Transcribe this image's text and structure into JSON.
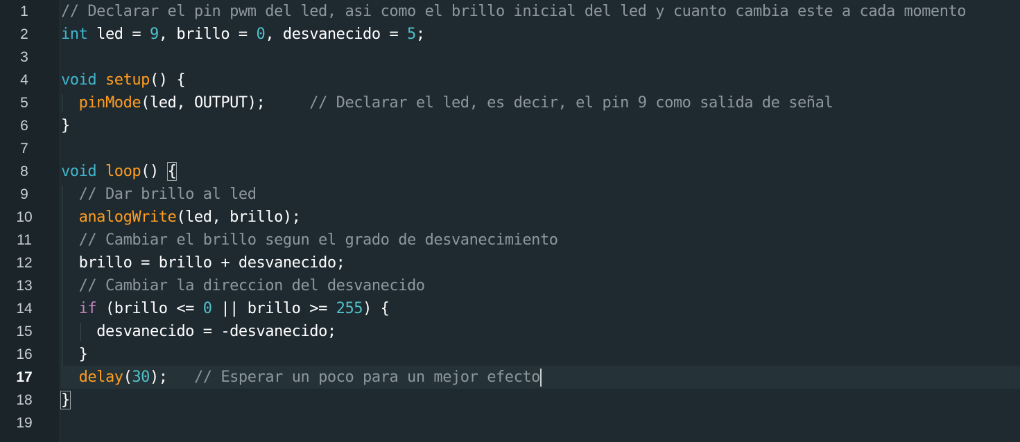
{
  "editor": {
    "active_line": 17,
    "line_numbers": [
      "1",
      "2",
      "3",
      "4",
      "5",
      "6",
      "7",
      "8",
      "9",
      "10",
      "11",
      "12",
      "13",
      "14",
      "15",
      "16",
      "17",
      "18",
      "19"
    ]
  },
  "code": {
    "l1_comment": "// Declarar el pin pwm del led, asi como el brillo inicial del led y cuanto cambia este a cada momento",
    "l2_int": "int",
    "l2_a": " led = ",
    "l2_n1": "9",
    "l2_b": ", brillo = ",
    "l2_n2": "0",
    "l2_c": ", desvanecido = ",
    "l2_n3": "5",
    "l2_d": ";",
    "l4_void": "void",
    "l4_fn": "setup",
    "l4_rest": "() {",
    "l5_fn": "pinMode",
    "l5_rest": "(led, OUTPUT);     ",
    "l5_comment": "// Declarar el led, es decir, el pin 9 como salida de señal",
    "l6": "}",
    "l8_void": "void",
    "l8_fn": "loop",
    "l8_rest": "() ",
    "l8_brace": "{",
    "l9_comment": "// Dar brillo al led",
    "l10_fn": "analogWrite",
    "l10_rest": "(led, brillo);",
    "l11_comment": "// Cambiar el brillo segun el grado de desvanecimiento",
    "l12": "brillo = brillo + desvanecido;",
    "l13_comment": "// Cambiar la direccion del desvanecido",
    "l14_if": "if",
    "l14_a": " (brillo <= ",
    "l14_n1": "0",
    "l14_b": " || brillo >= ",
    "l14_n2": "255",
    "l14_c": ") {",
    "l15": "desvanecido = -desvanecido;",
    "l16": "}",
    "l17_fn": "delay",
    "l17_a": "(",
    "l17_n": "30",
    "l17_b": ");   ",
    "l17_comment": "// Esperar un poco para un mejor efecto",
    "l18_brace": "}"
  },
  "colors": {
    "background": "#1f2a30",
    "gutter": "#1b2429",
    "comment": "#8d979d",
    "keyword": "#41b6cc",
    "control_keyword": "#c586c0",
    "function": "#ff9d1e",
    "number": "#4fc1c9",
    "text": "#ffffff"
  }
}
